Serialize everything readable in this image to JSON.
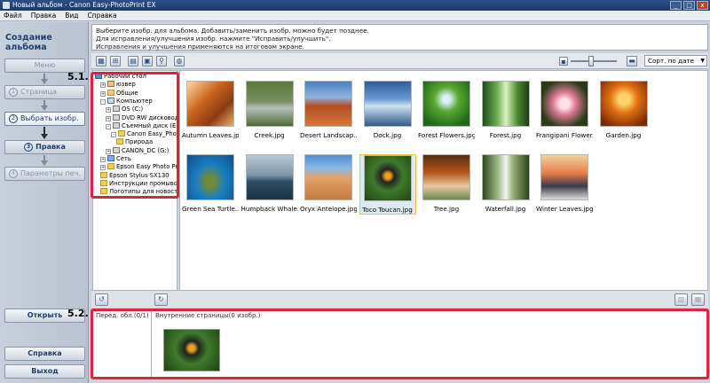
{
  "window": {
    "title": "Новый альбом - Canon Easy-PhotoPrint EX",
    "buttons": [
      "_",
      "□",
      "x"
    ]
  },
  "menu": [
    "Файл",
    "Правка",
    "Вид",
    "Справка"
  ],
  "sidebar": {
    "title": "Создание альбома",
    "steps": {
      "menu": "Меню",
      "page": "Страница",
      "select": "Выбрать изобр.",
      "edit": "Правка",
      "print": "Параметры печ."
    },
    "nums": {
      "page": "1",
      "select": "2",
      "edit": "3",
      "print": "4"
    },
    "open": "Открыть",
    "help": "Справка",
    "exit": "Выход"
  },
  "instructions": [
    "Выберите изобр. для альбома. Добавить/заменить изобр. можно будет позднее.",
    "Для исправления/улучшения изобр. нажмите \"Исправить/улучшить\".",
    "Исправления и улучшения применяются на итоговом экране."
  ],
  "toolbar": {
    "sort_value": "Сорт. по дате"
  },
  "tree": [
    {
      "label": "Рабочий стол",
      "icon": "desk",
      "indent": 0,
      "plus": ""
    },
    {
      "label": "юзвер",
      "icon": "user",
      "indent": 1,
      "plus": "+"
    },
    {
      "label": "Общие",
      "icon": "folder",
      "indent": 1,
      "plus": "+"
    },
    {
      "label": "Компьютер",
      "icon": "comp",
      "indent": 1,
      "plus": "-"
    },
    {
      "label": "OS (C:)",
      "icon": "drive",
      "indent": 2,
      "plus": "+"
    },
    {
      "label": "DVD RW дисковод (D",
      "icon": "drive",
      "indent": 2,
      "plus": "+"
    },
    {
      "label": "Съемный диск (E:)",
      "icon": "drive",
      "indent": 2,
      "plus": "-"
    },
    {
      "label": "Canon Easy_Photo",
      "icon": "folder",
      "indent": 3,
      "plus": "-"
    },
    {
      "label": "Природа",
      "icon": "folder",
      "indent": 4,
      "plus": ""
    },
    {
      "label": "CANON_DC (G:)",
      "icon": "drive",
      "indent": 2,
      "plus": "+"
    },
    {
      "label": "Сеть",
      "icon": "net",
      "indent": 1,
      "plus": "+"
    },
    {
      "label": "Epson Easy Photo Print",
      "icon": "folder",
      "indent": 1,
      "plus": "+"
    },
    {
      "label": "Epson Stylus SX130",
      "icon": "folder",
      "indent": 1,
      "plus": ""
    },
    {
      "label": "Инструкции промывочн",
      "icon": "folder",
      "indent": 1,
      "plus": ""
    },
    {
      "label": "Логотипы для новостей",
      "icon": "folder",
      "indent": 1,
      "plus": ""
    }
  ],
  "images": [
    {
      "name": "Autumn Leaves.jpg",
      "cls": "ph-autumn"
    },
    {
      "name": "Creek.jpg",
      "cls": "ph-creek"
    },
    {
      "name": "Desert Landscap...",
      "cls": "ph-desert"
    },
    {
      "name": "Dock.jpg",
      "cls": "ph-dock"
    },
    {
      "name": "Forest Flowers.jpg",
      "cls": "ph-forestfl"
    },
    {
      "name": "Forest.jpg",
      "cls": "ph-forest"
    },
    {
      "name": "Frangipani Flower...",
      "cls": "ph-frangi"
    },
    {
      "name": "Garden.jpg",
      "cls": "ph-garden"
    },
    {
      "name": "Green Sea Turtle...",
      "cls": "ph-turtle"
    },
    {
      "name": "Humpback Whale...",
      "cls": "ph-whale"
    },
    {
      "name": "Oryx Antelope.jpg",
      "cls": "ph-oryx"
    },
    {
      "name": "Toco Toucan.jpg",
      "cls": "ph-toco",
      "selected": true
    },
    {
      "name": "Tree.jpg",
      "cls": "ph-tree"
    },
    {
      "name": "Waterfall.jpg",
      "cls": "ph-waterfall"
    },
    {
      "name": "Winter Leaves.jpg",
      "cls": "ph-winter"
    }
  ],
  "tray": {
    "cover_label": "Перед. обл.(0/1)",
    "inner_label": "Внутренние страницы(0 изобр.)"
  },
  "callouts": {
    "c1": "5.1.",
    "c2": "5.2."
  },
  "colors": {
    "highlight": "#e0233c",
    "accent": "#1c3e72"
  }
}
